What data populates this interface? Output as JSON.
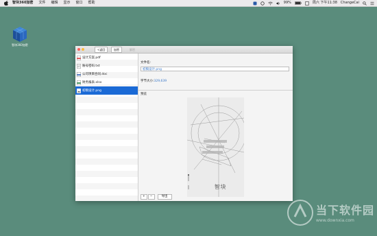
{
  "menubar": {
    "app_name": "智块360加密",
    "items": [
      "文件",
      "编辑",
      "显示",
      "窗口",
      "帮助"
    ],
    "battery": "99%",
    "datetime": "周六 下午11:38",
    "user": "ChangeCai"
  },
  "desktop": {
    "icon_label": "智块360加密"
  },
  "toolbar": {
    "back_label": "<返回",
    "encrypt_label": "加密",
    "decrypt_label": "解密"
  },
  "files": [
    {
      "name": "设计方案.pdf",
      "selected": false
    },
    {
      "name": "账号密码.txt",
      "selected": false
    },
    {
      "name": "公司项目合同.doc",
      "selected": false
    },
    {
      "name": "财务报表.xlsx",
      "selected": false
    },
    {
      "name": "初稿设计.png",
      "selected": true
    }
  ],
  "detail": {
    "filename_label": "文件名:",
    "filename_value": "初稿设计.png",
    "size_label": "字节大小:",
    "size_value": "329,639",
    "preview_label": "预览",
    "preview_caption": "智块"
  },
  "bottom": {
    "add_label": "+",
    "remove_label": "−",
    "export_label": "导出"
  },
  "watermark": {
    "name": "当下软件园",
    "url": "www.downxia.com"
  },
  "colors": {
    "desktop": "#5a8c7c",
    "selection": "#1b6ad6",
    "value_text": "#3a78c8"
  }
}
